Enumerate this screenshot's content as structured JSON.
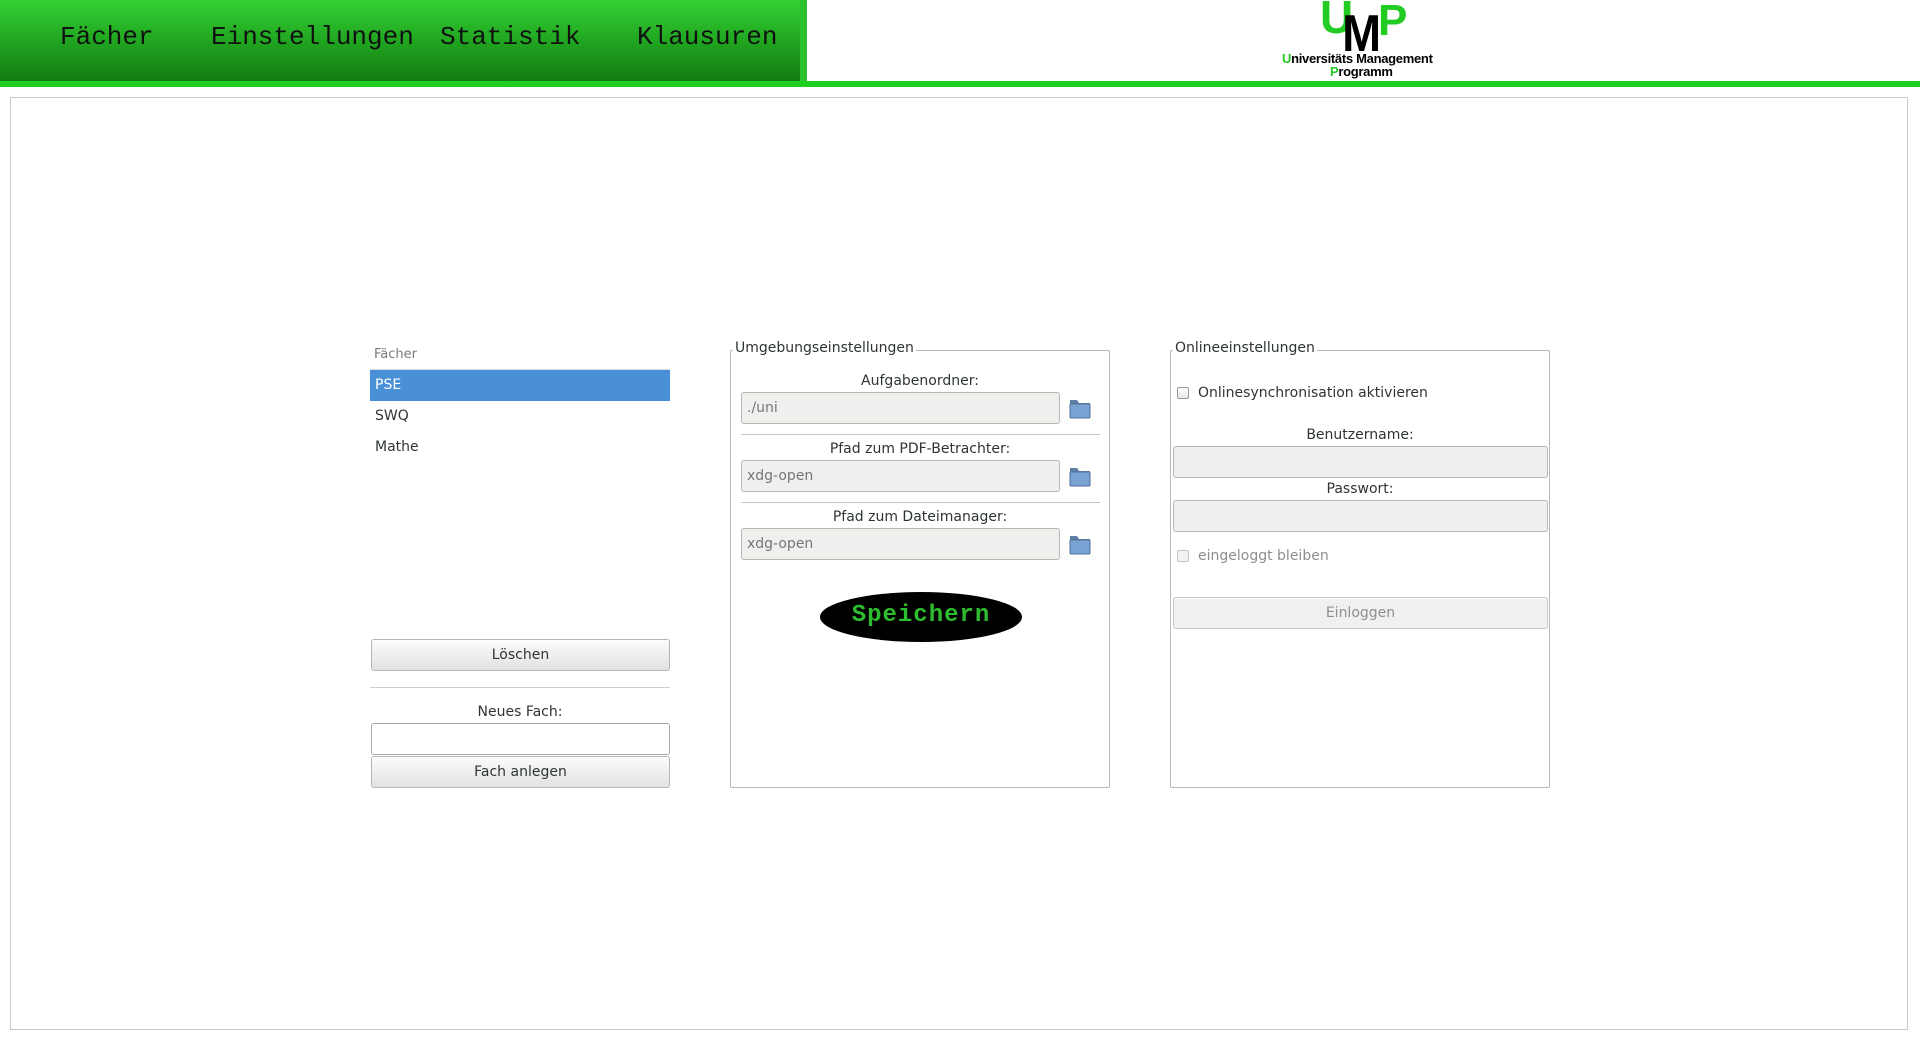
{
  "nav": {
    "items": [
      "Fächer",
      "Einstellungen",
      "Statistik",
      "Klausuren"
    ]
  },
  "logo": {
    "letters": [
      "U",
      "M",
      "P"
    ],
    "line1_first": "U",
    "line1_rest": "niversitäts Management",
    "line2_first": "P",
    "line2_rest": "rogramm"
  },
  "subjects": {
    "header": "Fächer",
    "items": [
      "PSE",
      "SWQ",
      "Mathe"
    ],
    "selected": "PSE",
    "delete_label": "Löschen",
    "new_subject_label": "Neues Fach:",
    "new_subject_value": "",
    "create_label": "Fach anlegen"
  },
  "environment": {
    "title": "Umgebungseinstellungen",
    "task_folder_label": "Aufgabenordner:",
    "task_folder_placeholder": "./uni",
    "pdf_viewer_label": "Pfad zum PDF-Betrachter:",
    "pdf_viewer_placeholder": "xdg-open",
    "file_manager_label": "Pfad zum Dateimanager:",
    "file_manager_placeholder": "xdg-open",
    "save_label": "Speichern"
  },
  "online": {
    "title": "Onlineeinstellungen",
    "sync_label": "Onlinesynchronisation aktivieren",
    "sync_checked": false,
    "username_label": "Benutzername:",
    "password_label": "Passwort:",
    "stay_logged_in_label": "eingeloggt bleiben",
    "stay_logged_in_checked": false,
    "login_label": "Einloggen"
  },
  "colors": {
    "nav_green": "#1fa21f",
    "accent_line": "#1fcf1f",
    "selection": "#4a90d9",
    "save_text": "#2ebd2e"
  },
  "icons": [
    "folder-icon"
  ]
}
